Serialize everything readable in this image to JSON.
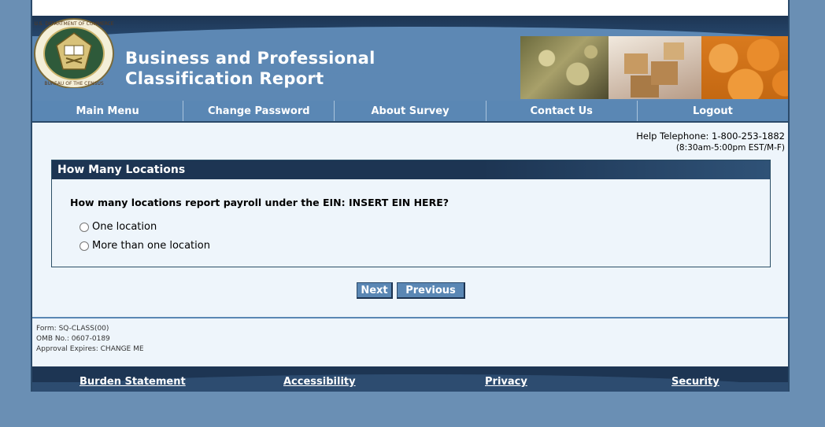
{
  "header": {
    "title_line1": "Business and Professional",
    "title_line2": "Classification Report",
    "seal_text": "U.S. DEPARTMENT OF COMMERCE · BUREAU OF THE CENSUS"
  },
  "nav": {
    "items": [
      {
        "label": "Main Menu"
      },
      {
        "label": "Change Password"
      },
      {
        "label": "About Survey"
      },
      {
        "label": "Contact Us"
      },
      {
        "label": "Logout"
      }
    ]
  },
  "help": {
    "telephone": "Help Telephone: 1-800-253-1882",
    "hours": "(8:30am-5:00pm EST/M-F)"
  },
  "panel": {
    "title": "How Many Locations",
    "question": "How many locations report payroll under the EIN: INSERT EIN HERE?",
    "options": [
      {
        "label": "One location",
        "selected": false
      },
      {
        "label": "More than one location",
        "selected": false
      }
    ]
  },
  "buttons": {
    "next": "Next",
    "previous": "Previous"
  },
  "form_info": {
    "form": "Form: SQ-CLASS(00)",
    "omb": "OMB No.: 0607-0189",
    "approval": "Approval Expires: CHANGE ME"
  },
  "footer": {
    "links": [
      {
        "label": "Burden Statement"
      },
      {
        "label": "Accessibility"
      },
      {
        "label": "Privacy"
      },
      {
        "label": "Security"
      }
    ]
  },
  "colors": {
    "background": "#6a8fb4",
    "nav_blue": "#5a87b4",
    "dark_navy": "#1d3553",
    "content_bg": "#eef5fb"
  }
}
